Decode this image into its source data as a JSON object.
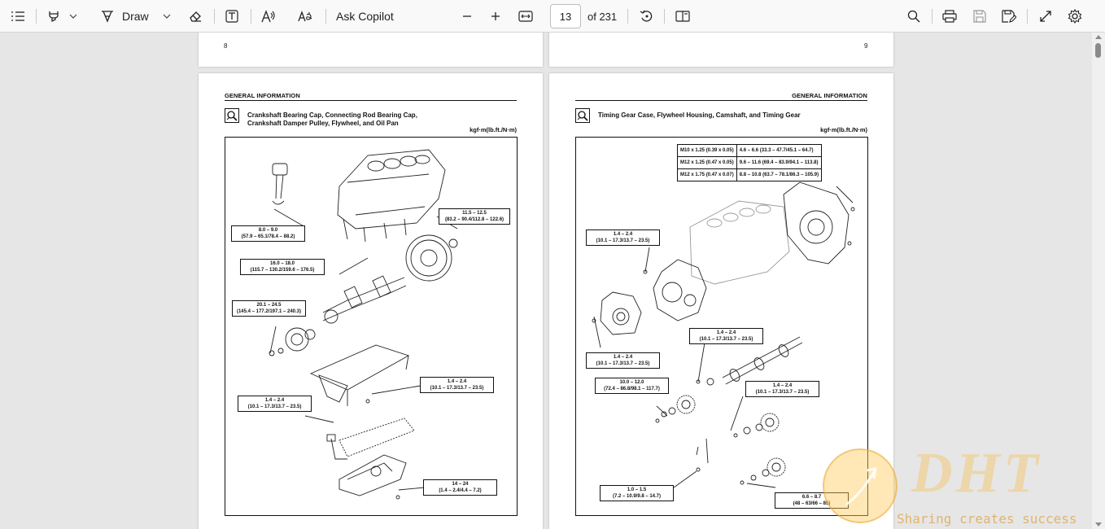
{
  "toolbar": {
    "draw_label": "Draw",
    "copilot_label": "Ask Copilot",
    "page_current": "13",
    "page_total": "of 231"
  },
  "pages": {
    "page8_number": "8",
    "page9_number": "9",
    "left": {
      "header": "GENERAL INFORMATION",
      "title_line1": "Crankshaft Bearing Cap, Connecting Rod Bearing Cap,",
      "title_line2": "Crankshaft Damper Pulley, Flywheel, and Oil Pan",
      "unit": "kgf·m(lb.ft./N·m)",
      "labels": [
        {
          "l1": "8.0 – 9.0",
          "l2": "(57.9 – 65.1/78.4 – 88.2)"
        },
        {
          "l1": "16.0 – 18.0",
          "l2": "(115.7 – 130.2/159.6 – 176.5)"
        },
        {
          "l1": "11.5 – 12.5",
          "l2": "(83.2 – 90.4/112.8 – 122.6)"
        },
        {
          "l1": "20.1 – 24.5",
          "l2": "(145.4 – 177.2/197.1 – 240.3)"
        },
        {
          "l1": "1.4 – 2.4",
          "l2": "(10.1 – 17.3/13.7 – 23.5)"
        },
        {
          "l1": "1.4 – 2.4",
          "l2": "(10.1 – 17.3/13.7 – 23.5)"
        },
        {
          "l1": "14 – 24",
          "l2": "(1.4 – 2.4/4.4 – 7.2)"
        }
      ]
    },
    "right": {
      "header": "GENERAL INFORMATION",
      "title": "Timing Gear Case, Flywheel Housing, Camshaft, and Timing Gear",
      "unit": "kgf·m(lb.ft./N·m)",
      "table": [
        {
          "size": "M10 x 1.25 (0.39 x 0.05)",
          "torque": "4.6 – 6.6 (33.3 – 47.7/45.1 – 64.7)"
        },
        {
          "size": "M12 x 1.25 (0.47 x 0.05)",
          "torque": "9.6 – 11.6 (69.4 – 83.9/94.1 – 113.8)"
        },
        {
          "size": "M12 x 1.75 (0.47 x 0.07)",
          "torque": "8.8 – 10.8 (63.7 – 78.1/86.3 – 105.9)"
        }
      ],
      "labels": [
        {
          "l1": "1.4 – 2.4",
          "l2": "(10.1 – 17.3/13.7 – 23.5)"
        },
        {
          "l1": "1.4 – 2.4",
          "l2": "(10.1 – 17.3/13.7 – 23.5)"
        },
        {
          "l1": "1.4 – 2.4",
          "l2": "(10.1 – 17.3/13.7 – 23.5)"
        },
        {
          "l1": "10.0 – 12.0",
          "l2": "(72.4 – 86.8/98.1 – 117.7)"
        },
        {
          "l1": "1.4 – 2.4",
          "l2": "(10.1 – 17.3/13.7 – 23.5)"
        },
        {
          "l1": "1.0 – 1.5",
          "l2": "(7.2 – 10.9/9.8 – 14.7)"
        },
        {
          "l1": "6.6 – 8.7",
          "l2": "(48 – 63/66 – 85)"
        }
      ]
    }
  },
  "watermark": {
    "brand": "DHT",
    "tagline": "Sharing creates success"
  }
}
